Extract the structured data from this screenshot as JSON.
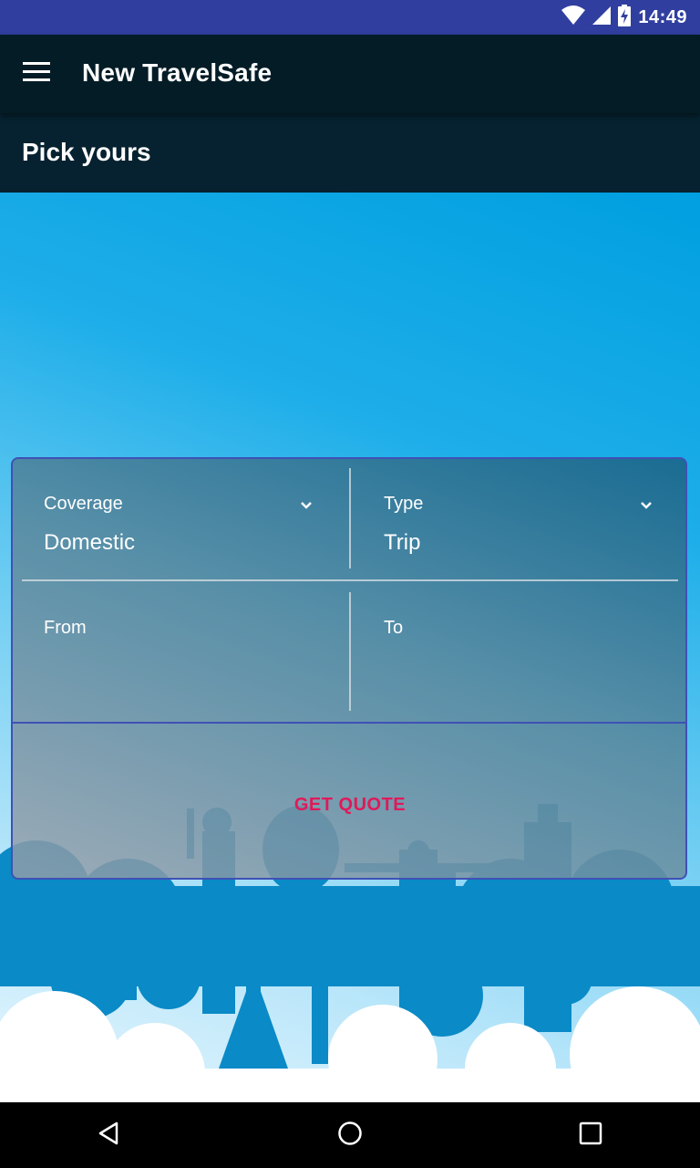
{
  "status_bar": {
    "time": "14:49",
    "icons": [
      "wifi-icon",
      "cellular-signal-icon",
      "battery-charging-icon"
    ]
  },
  "app_bar": {
    "title": "New TravelSafe",
    "menu_icon": "hamburger-menu-icon"
  },
  "subheader": {
    "title": "Pick yours"
  },
  "form": {
    "coverage": {
      "label": "Coverage",
      "value": "Domestic",
      "icon": "chevron-down-icon"
    },
    "type": {
      "label": "Type",
      "value": "Trip",
      "icon": "chevron-down-icon"
    },
    "from": {
      "label": "From",
      "value": ""
    },
    "to": {
      "label": "To",
      "value": ""
    },
    "submit_label": "GET QUOTE"
  },
  "nav_bar": {
    "buttons": [
      "back-triangle-icon",
      "home-circle-icon",
      "recents-square-icon"
    ]
  },
  "colors": {
    "status_bar": "#303f9f",
    "app_bar": "#031c26",
    "accent": "#e0195a",
    "card_border": "#3f51b5",
    "sky": "#009fe0"
  }
}
